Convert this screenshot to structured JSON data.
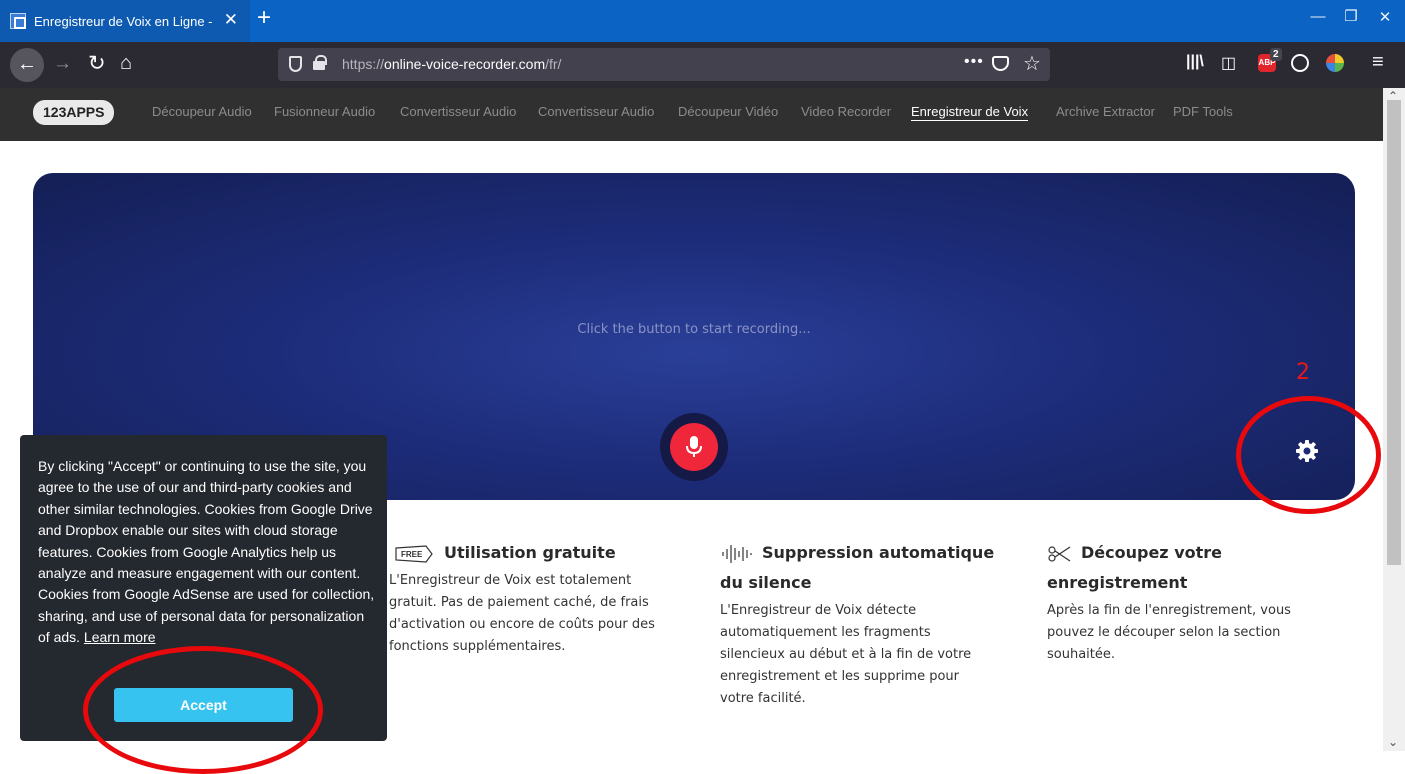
{
  "browser": {
    "tab_title": "Enregistreur de Voix en Ligne -",
    "new_tab_symbol": "+",
    "close_symbol": "✕",
    "url_scheme": "https://",
    "url_host": "online-voice-recorder.com",
    "url_path": "/fr/",
    "adblock_label": "ABP",
    "adblock_badge": "2",
    "icons": [
      "back-icon",
      "forward-icon",
      "reload-icon",
      "home-icon",
      "shield-icon",
      "lock-icon",
      "more-icon",
      "pocket-icon",
      "star-icon",
      "library-icon",
      "sidebar-icon",
      "adblock-icon",
      "account-icon",
      "extension-icon",
      "menu-icon"
    ]
  },
  "site_nav": {
    "logo": "123APPS",
    "items": [
      {
        "label": "Découpeur Audio",
        "active": false
      },
      {
        "label": "Fusionneur Audio",
        "active": false
      },
      {
        "label": "Convertisseur Audio",
        "active": false
      },
      {
        "label": "Convertisseur Audio",
        "active": false
      },
      {
        "label": "Découpeur Vidéo",
        "active": false
      },
      {
        "label": "Video Recorder",
        "active": false
      },
      {
        "label": "Enregistreur de Voix",
        "active": true
      },
      {
        "label": "Archive Extractor",
        "active": false
      },
      {
        "label": "PDF Tools",
        "active": false
      }
    ]
  },
  "recorder": {
    "hint": "Click the button to start recording...",
    "record_color": "#f0263a"
  },
  "annotation": {
    "number": "2",
    "color": "#e8090c"
  },
  "features": [
    {
      "icon": "free-tag-icon",
      "title": "Utilisation gratuite",
      "text": "L'Enregistreur de Voix est totalement gratuit. Pas de paiement caché, de frais d'activation ou encore de coûts pour des fonctions supplémentaires."
    },
    {
      "icon": "waveform-icon",
      "title": "Suppression automatique du silence",
      "text": "L'Enregistreur de Voix détecte automatiquement les fragments silencieux au début et à la fin de votre enregistrement et les supprime pour votre facilité."
    },
    {
      "icon": "scissors-icon",
      "title": "Découpez votre enregistrement",
      "text": "Après la fin de l'enregistrement, vous pouvez le découper selon la section souhaitée."
    }
  ],
  "cookie": {
    "text": "By clicking \"Accept\" or continuing to use the site, you agree to the use of our and third-party cookies and other similar technologies. Cookies from Google Drive and Dropbox enable our sites with cloud storage features. Cookies from Google Analytics help us analyze and measure engagement with our content. Cookies from Google AdSense are used for collection, sharing, and use of personal data for personalization of ads.",
    "learn_more": "Learn more",
    "accept": "Accept",
    "accent": "#36c3f0"
  }
}
